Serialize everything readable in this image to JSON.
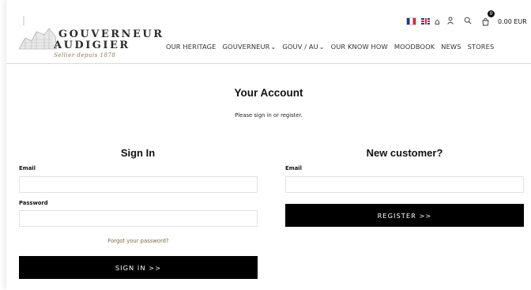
{
  "brand": {
    "line1": "GOUVERNEUR",
    "line2": "AUDIGIER",
    "tagline": "Sellier depuis 1878"
  },
  "nav": {
    "items": [
      {
        "label": "OUR HERITAGE"
      },
      {
        "label": "GOUVERNEUR"
      },
      {
        "label": "GOUV / AU"
      },
      {
        "label": "OUR KNOW HOW"
      },
      {
        "label": "MOODBOOK"
      },
      {
        "label": "NEWS"
      },
      {
        "label": "STORES"
      }
    ]
  },
  "utilities": {
    "cart_count": "0",
    "cart_total": "0.00 EUR"
  },
  "account": {
    "title": "Your Account",
    "subtitle": "Please sign in or register."
  },
  "signin": {
    "title": "Sign In",
    "email_label": "Email",
    "email_value": "",
    "password_label": "Password",
    "password_value": "",
    "forgot_label": "Forgot your password?",
    "button_label": "SIGN IN >>"
  },
  "register": {
    "title": "New customer?",
    "email_label": "Email",
    "email_value": "",
    "button_label": "REGISTER >>"
  },
  "colors": {
    "button_bg": "#000000",
    "link_gold": "#7a6a3a"
  }
}
